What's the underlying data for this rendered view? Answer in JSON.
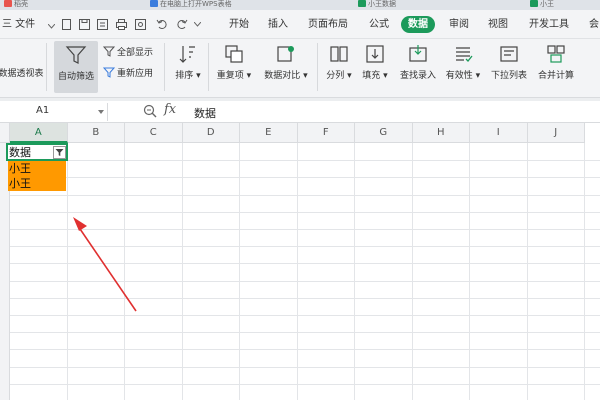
{
  "tabstrip": {
    "tabs": [
      {
        "label": "稻壳"
      },
      {
        "label": "在电脑上打开WPS表格"
      },
      {
        "label": "小王数据"
      },
      {
        "label": "小王"
      }
    ]
  },
  "menubar": {
    "file_label": "三 文件",
    "tabs": [
      "开始",
      "插入",
      "页面布局",
      "公式",
      "数据",
      "审阅",
      "视图",
      "开发工具",
      "会"
    ],
    "active_tab": "数据"
  },
  "ribbon": {
    "pivot_label": "数据透视表",
    "autofilter_label": "自动筛选",
    "show_all_label": "全部显示",
    "reapply_label": "重新应用",
    "sort_label": "排序",
    "duplicates_label": "重复项",
    "compare_label": "数据对比",
    "split_label": "分列",
    "fill_label": "填充",
    "lookup_label": "查找录入",
    "validity_label": "有效性",
    "dropdown_label": "下拉列表",
    "consolidate_label": "合并计算"
  },
  "formula_bar": {
    "name_box": "A1",
    "fx_label": "fx",
    "formula": "数据"
  },
  "sheet": {
    "columns": [
      "A",
      "B",
      "C",
      "D",
      "E",
      "F",
      "G",
      "H",
      "I",
      "J"
    ],
    "selected_column": "A",
    "cells": {
      "A1": "数据",
      "A2": "小王",
      "A3": "小王"
    },
    "highlight_color": "#ff9900",
    "accent_color": "#1c9a5b",
    "annotation_color": "#e03030"
  }
}
